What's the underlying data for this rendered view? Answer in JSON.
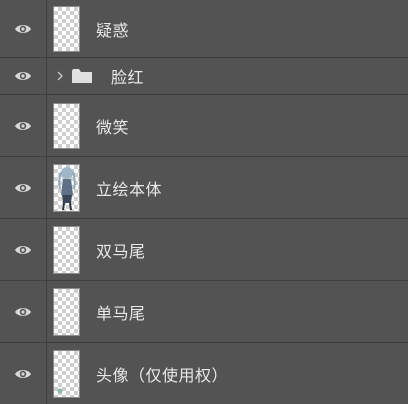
{
  "layers": [
    {
      "name": "疑惑",
      "visible": true,
      "type": "layer"
    },
    {
      "name": "脸红",
      "visible": true,
      "type": "group",
      "expanded": false
    },
    {
      "name": "微笑",
      "visible": true,
      "type": "layer"
    },
    {
      "name": "立绘本体",
      "visible": true,
      "type": "layer"
    },
    {
      "name": "双马尾",
      "visible": true,
      "type": "layer"
    },
    {
      "name": "单马尾",
      "visible": true,
      "type": "layer"
    },
    {
      "name": "头像（仅使用权）",
      "visible": true,
      "type": "layer"
    }
  ],
  "icons": {
    "visibility": "eye-icon",
    "group_toggle": "chevron-right-icon",
    "group": "folder-icon"
  },
  "colors": {
    "panel_bg": "#535353",
    "divider": "#3e3e3e",
    "text": "#e8e8e8"
  }
}
